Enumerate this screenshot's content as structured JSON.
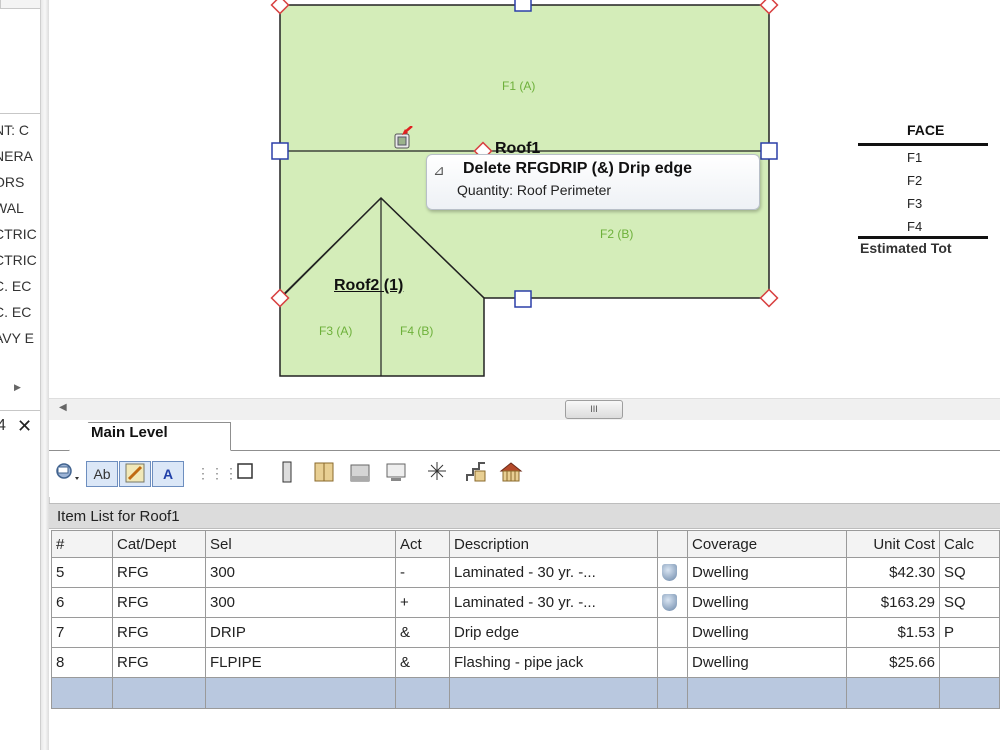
{
  "left_panel": {
    "items": [
      "NT: C",
      "NERA",
      "ORS",
      "WAL",
      "CTRIC",
      "CTRIC",
      "C. EC",
      "C. EC",
      "AVY E"
    ],
    "pin_glyph": "4",
    "close_glyph": "✕"
  },
  "drawing": {
    "faces": [
      "F1 (A)",
      "F2 (B)",
      "F3 (A)",
      "F4 (B)"
    ],
    "roofs": [
      "Roof1",
      "Roof2  (1)"
    ],
    "face_color": "#d4edb9",
    "tooltip": {
      "title": "Delete RFGDRIP (&)  Drip edge",
      "subtitle": "Quantity:  Roof Perimeter"
    }
  },
  "face_table": {
    "header": "FACE",
    "rows": [
      "F1",
      "F2",
      "F3",
      "F4"
    ],
    "total_label": "Estimated Tot"
  },
  "scrollbar": {
    "thumb_glyph": "III"
  },
  "tabs": [
    {
      "label": "Main Level"
    }
  ],
  "toolbar": {
    "ab_label": "Ab",
    "a_label": "A"
  },
  "item_list": {
    "title": "Item List for Roof1",
    "columns": [
      "#",
      "Cat/Dept",
      "Sel",
      "Act",
      "Description",
      "",
      "Coverage",
      "Unit Cost",
      "Calc"
    ],
    "rows": [
      {
        "num": "5",
        "cat": "RFG",
        "sel": "300",
        "act": "-",
        "desc": "Laminated - 30 yr. -...",
        "icon": true,
        "coverage": "Dwelling",
        "unit_cost": "$42.30",
        "calc": "SQ"
      },
      {
        "num": "6",
        "cat": "RFG",
        "sel": "300",
        "act": "+",
        "desc": "Laminated - 30 yr. -...",
        "icon": true,
        "coverage": "Dwelling",
        "unit_cost": "$163.29",
        "calc": "SQ"
      },
      {
        "num": "7",
        "cat": "RFG",
        "sel": "DRIP",
        "act": "&",
        "desc": "Drip edge",
        "icon": false,
        "coverage": "Dwelling",
        "unit_cost": "$1.53",
        "calc": "P"
      },
      {
        "num": "8",
        "cat": "RFG",
        "sel": "FLPIPE",
        "act": "&",
        "desc": "Flashing - pipe jack",
        "icon": false,
        "coverage": "Dwelling",
        "unit_cost": "$25.66",
        "calc": ""
      }
    ]
  }
}
